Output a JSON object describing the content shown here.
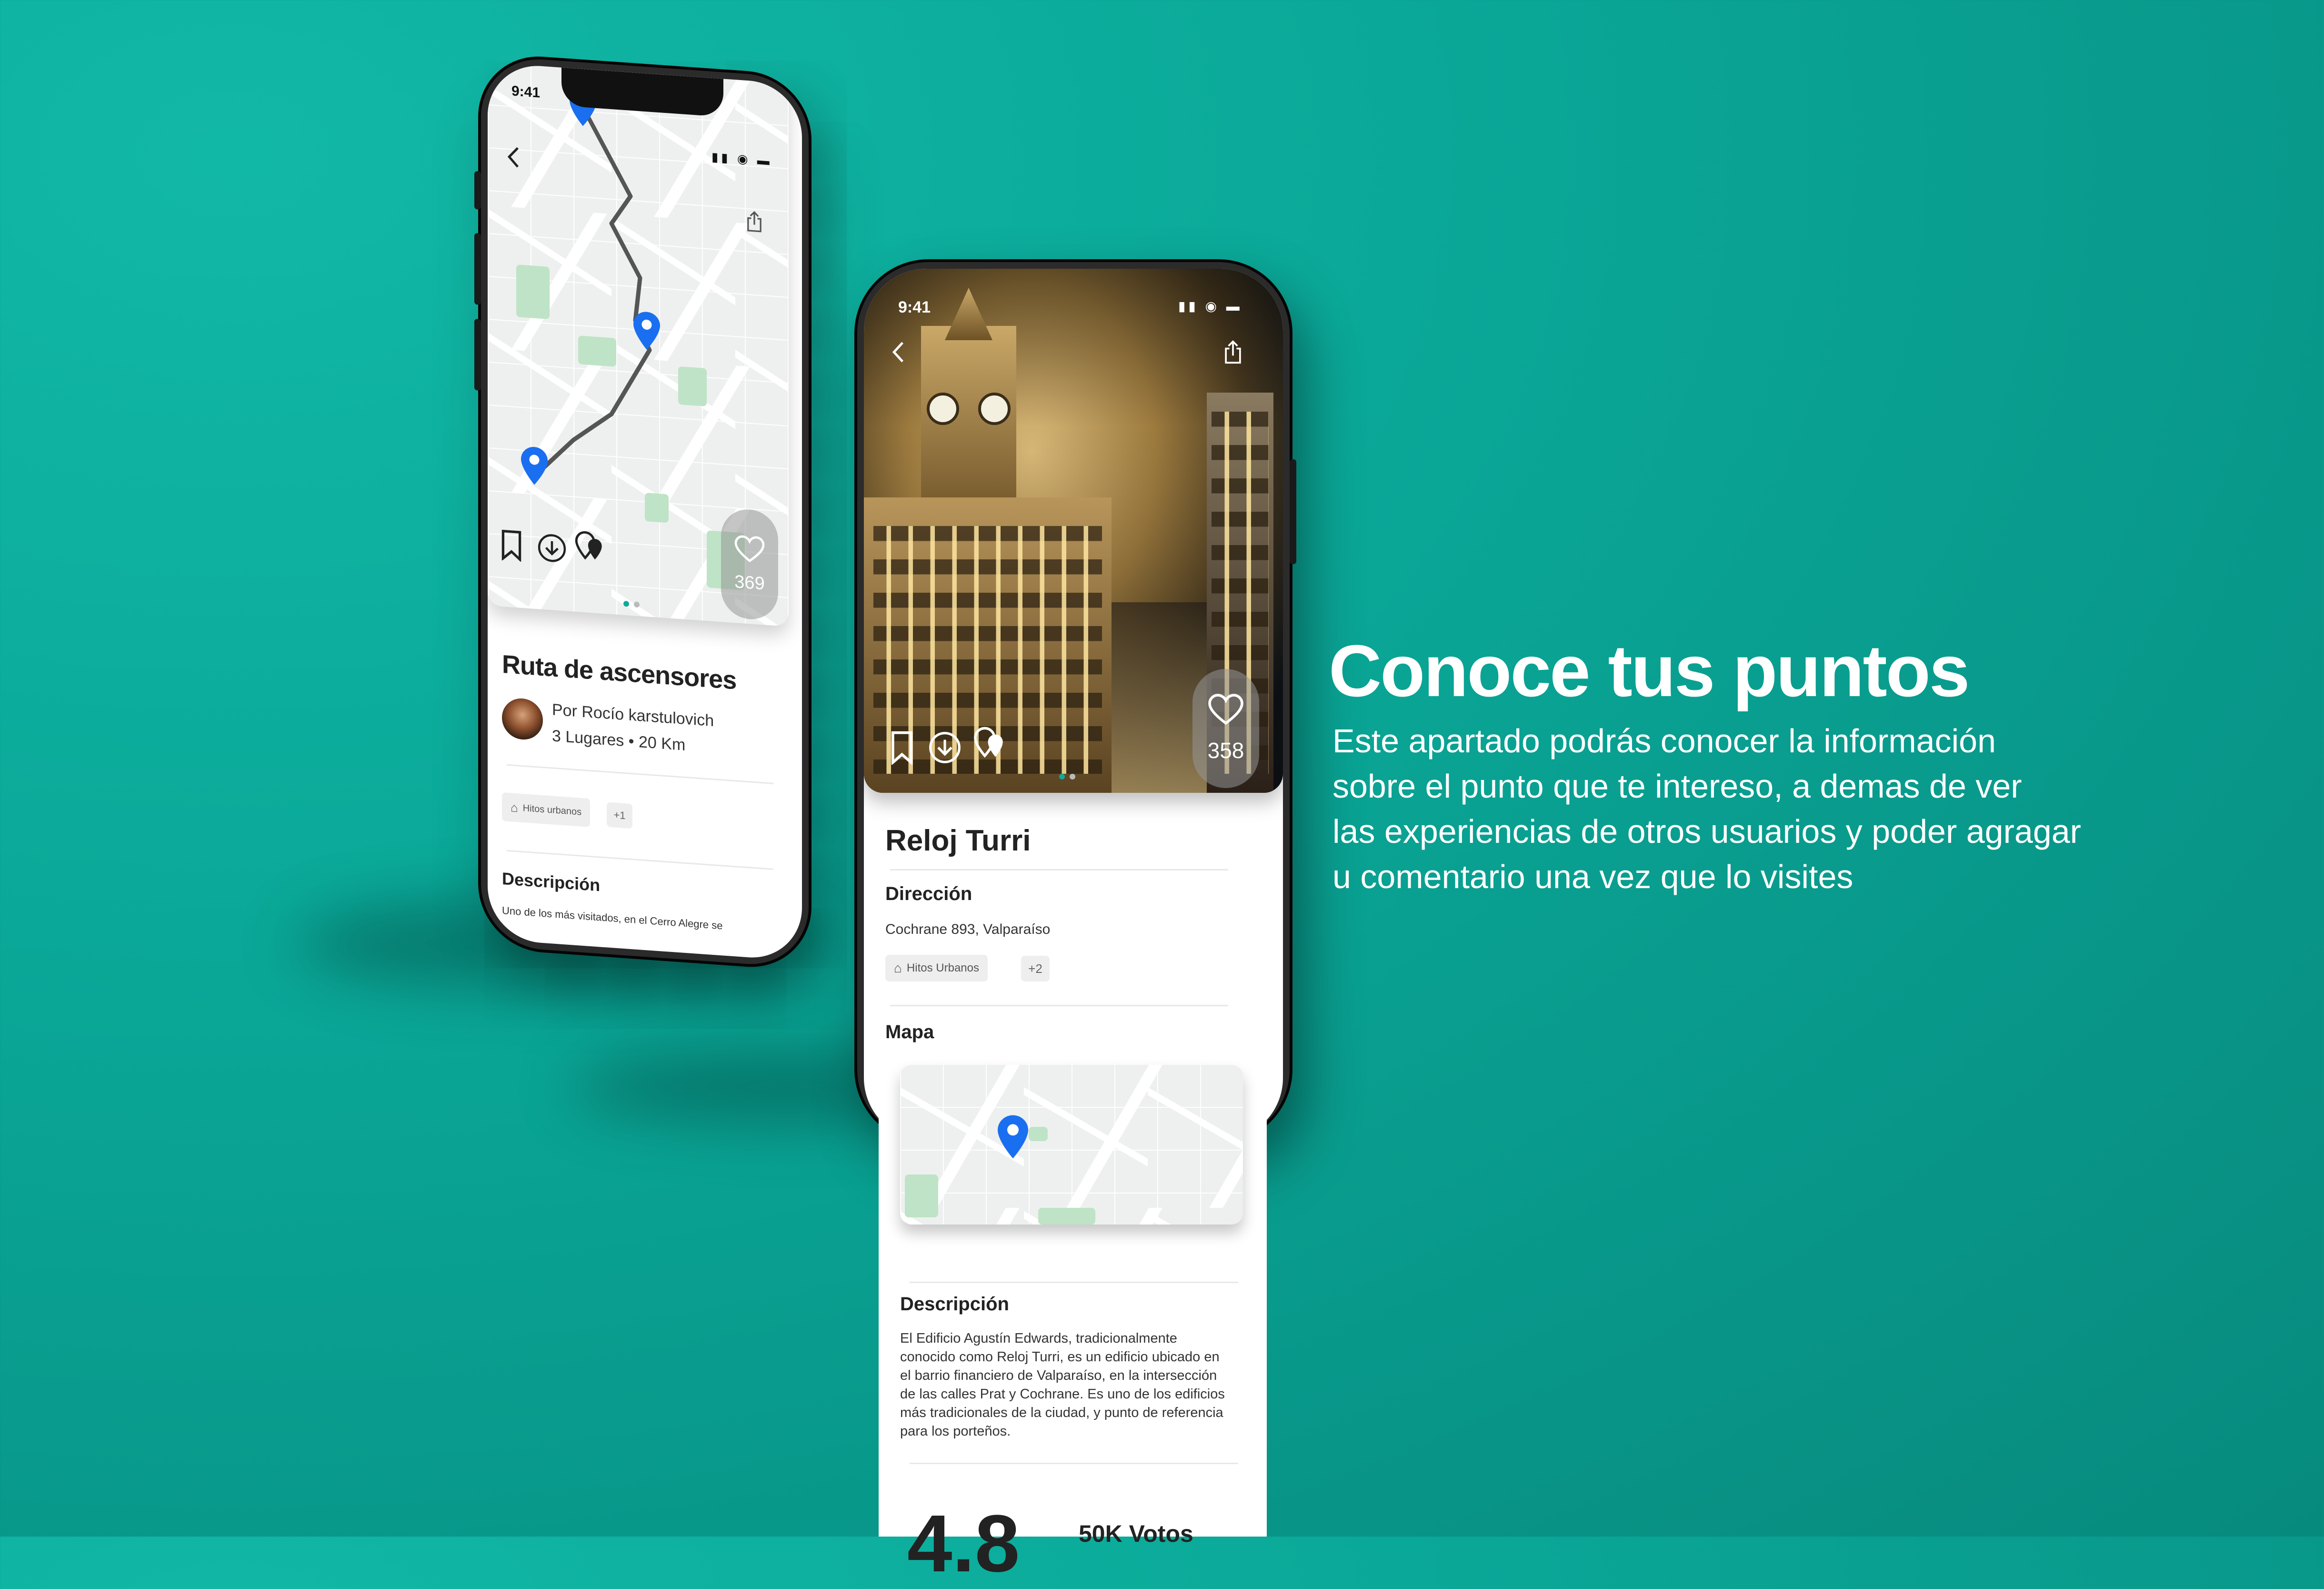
{
  "background": {
    "color_start": "#12b8a6",
    "color_end": "#078a7e"
  },
  "phone1": {
    "status_time": "9:41",
    "like_count": "369",
    "title": "Ruta de ascensores",
    "author": "Por Rocío karstulovich",
    "meta": "3 Lugares • 20 Km",
    "tag": "Hitos urbanos",
    "tag_more": "+1",
    "section_description": "Descripción",
    "description_preview": "Uno de los más visitados, en el Cerro Alegre se"
  },
  "phone2": {
    "status_time": "9:41",
    "like_count": "358",
    "title": "Reloj Turri",
    "address_label": "Dirección",
    "address": "Cochrane 893, Valparaíso",
    "tag": "Hitos Urbanos",
    "tag_more": "+2",
    "map_label": "Mapa",
    "description_label": "Descripción",
    "description": [
      "El Edificio Agustín Edwards, tradicionalmente",
      "conocido como Reloj Turri, es un edificio ubicado en",
      "el barrio financiero de Valparaíso, en la intersección",
      "de las calles Prat y Cochrane. Es uno de los edificios",
      "más tradicionales de la ciudad, y punto de referencia",
      "para los porteños."
    ],
    "rating_partial": "4.8",
    "votes_partial": "50K Votos"
  },
  "headline": "Conoce tus puntos",
  "body_lines": [
    "Este apartado podrás conocer la información",
    "sobre el punto que te intereso, a demas de ver",
    "las experiencias de otros usuarios y poder agragar",
    "u comentario una vez que lo visites"
  ],
  "icons": {
    "back": "chevron-left-icon",
    "share": "share-icon",
    "bookmark": "bookmark-icon",
    "download": "download-icon",
    "pins": "map-pins-icon",
    "heart": "heart-icon",
    "pin": "map-pin-icon"
  },
  "accent": "#1a6ff0"
}
